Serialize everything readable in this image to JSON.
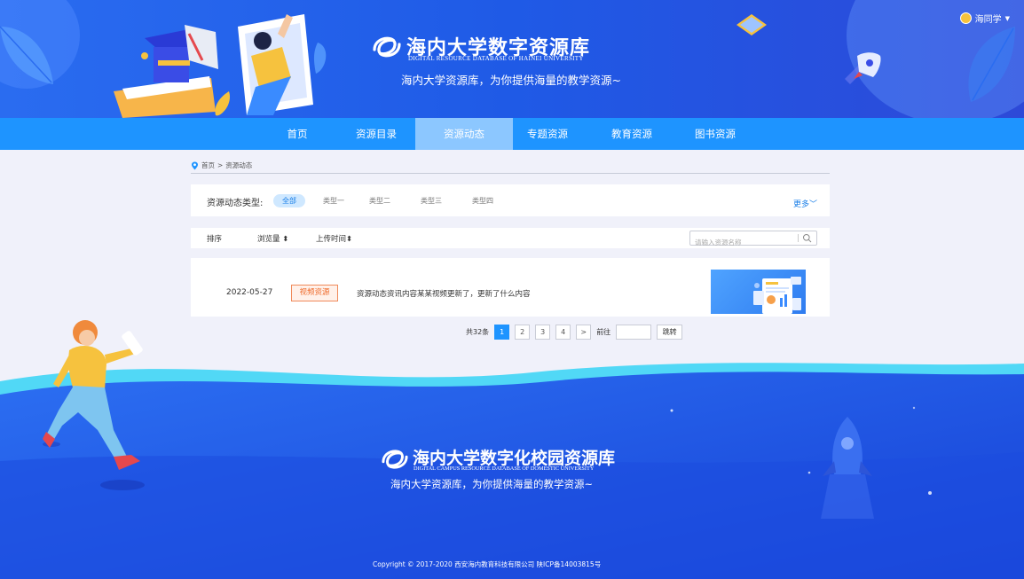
{
  "header": {
    "title": "海内大学数字资源库",
    "subtitle": "DIGITAL RESOURCE DATABASE OF HAINEI UNIVERSITY",
    "tagline": "海内大学资源库，为你提供海量的教学资源~",
    "user_name": "海同学"
  },
  "nav": {
    "items": [
      {
        "label": "首页"
      },
      {
        "label": "资源目录"
      },
      {
        "label": "资源动态"
      },
      {
        "label": "专题资源"
      },
      {
        "label": "教育资源"
      },
      {
        "label": "图书资源"
      }
    ],
    "active_index": 2
  },
  "breadcrumb": {
    "home": "首页",
    "separator": ">",
    "current": "资源动态"
  },
  "filter": {
    "label": "资源动态类型:",
    "chips": [
      "全部",
      "类型一",
      "类型二",
      "类型三",
      "类型四"
    ],
    "active_chip": "全部",
    "more": "更多"
  },
  "sort": {
    "label": "排序",
    "by_views": "浏览量",
    "by_upload": "上传时间",
    "search_placeholder": "请输入资源名称"
  },
  "list": {
    "items": [
      {
        "date": "2022-05-27",
        "tag": "视频资源",
        "description": "资源动态资讯内容某某视频更新了，更新了什么内容"
      }
    ]
  },
  "pagination": {
    "total": "共32条",
    "pages": [
      "1",
      "2",
      "3",
      "4"
    ],
    "current_page": "1",
    "prev": "<",
    "next": ">",
    "goto_label": "前往",
    "jump_label": "跳转"
  },
  "footer": {
    "title": "海内大学数字化校园资源库",
    "subtitle": "DIGITAL CAMPUS RESOURCE DATABASE OF DOMESTIC UNIVERSITY",
    "tagline": "海内大学资源库，为你提供海量的教学资源~",
    "copyright": "Copyright © 2017-2020 西安海内教育科技有限公司 陕ICP备14003815号"
  },
  "colors": {
    "primary": "#1e94ff",
    "nav_active": "#8cc7ff",
    "header_blue": "#2a6cf0",
    "footer_blue": "#1a4fe0",
    "tag_orange": "#ef6b2c",
    "page_bg": "#f0f1fa"
  }
}
